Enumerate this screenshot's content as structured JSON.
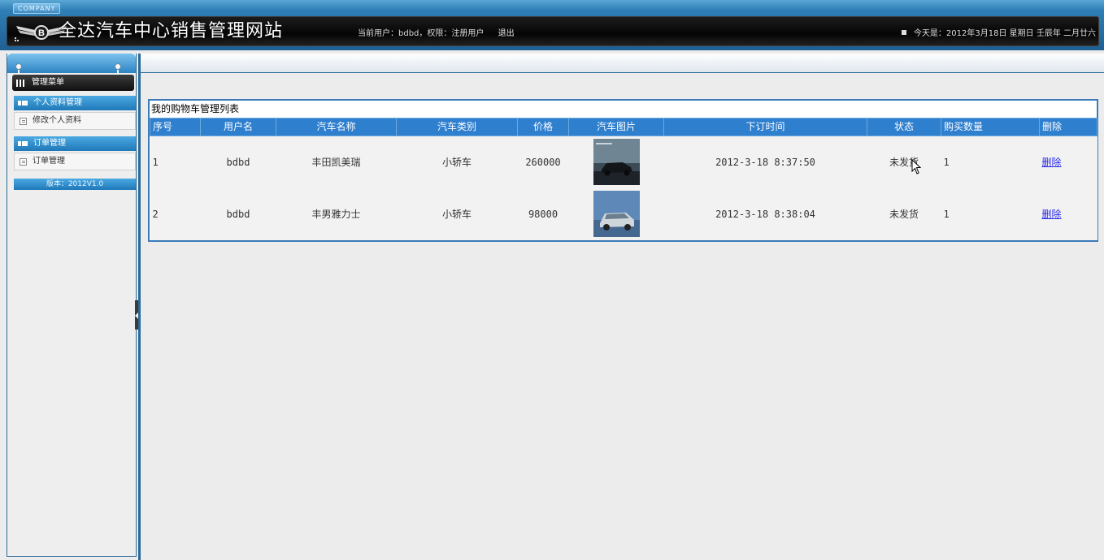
{
  "header": {
    "company_tag": "COMPANY",
    "site_title": "全达汽车中心销售管理网站",
    "user_info": "当前用户：bdbd，权限：注册用户",
    "logout_label": "退出",
    "date_text": "今天是：2012年3月18日 星期日 壬辰年 二月廿六"
  },
  "sidebar": {
    "menu_title": "管理菜单",
    "groups": [
      {
        "label": "个人资料管理",
        "items": [
          {
            "label": "修改个人资料"
          }
        ]
      },
      {
        "label": "订单管理",
        "items": [
          {
            "label": "订单管理"
          }
        ]
      }
    ],
    "version": "版本：2012V1.0"
  },
  "main": {
    "panel_title": "我的购物车管理列表",
    "columns": [
      "序号",
      "用户名",
      "汽车名称",
      "汽车类别",
      "价格",
      "汽车图片",
      "下订时间",
      "状态",
      "购买数量",
      "删除"
    ],
    "rows": [
      {
        "id": "1",
        "user": "bdbd",
        "car_name": "丰田凯美瑞",
        "category": "小轿车",
        "price": "260000",
        "time": "2012-3-18 8:37:50",
        "status": "未发货",
        "qty": "1",
        "delete": "删除",
        "image": "car-photo-dark"
      },
      {
        "id": "2",
        "user": "bdbd",
        "car_name": "丰男雅力士",
        "category": "小轿车",
        "price": "98000",
        "time": "2012-3-18 8:38:04",
        "status": "未发货",
        "qty": "1",
        "delete": "删除",
        "image": "car-photo-silver"
      }
    ]
  },
  "icons": {
    "logo": "bentley-wings-logo",
    "menu": "grid-icon",
    "group": "folder-bar-icon",
    "item": "document-icon"
  },
  "colors": {
    "header_blue": "#2f7fb6",
    "table_header": "#2f7fcf",
    "link": "#2a2aee"
  }
}
